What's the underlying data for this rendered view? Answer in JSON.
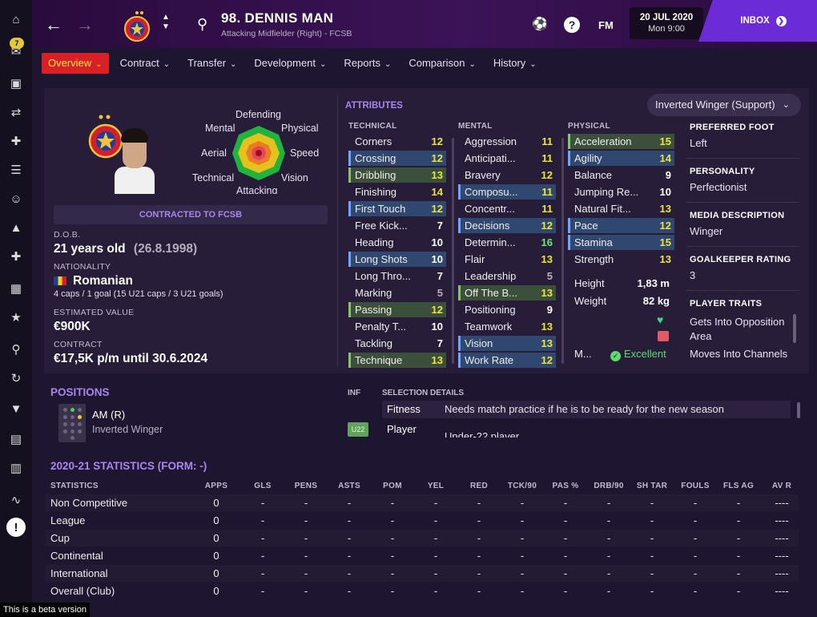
{
  "colors": {
    "accent": "#a985ec",
    "active_tab": "#d92027",
    "highlight_value": "#ece53a",
    "good": "#6fe67e",
    "inbox": "#6b2bd6"
  },
  "sidebar": {
    "badge": "7",
    "icons": [
      "home-icon",
      "inbox-icon",
      "squad-icon",
      "tactics-icon",
      "injury-icon",
      "clipboard-icon",
      "staff-icon",
      "training-icon",
      "medical-icon",
      "schedule-icon",
      "trophy-icon",
      "scouting-icon",
      "transfers-icon",
      "club-vision-icon",
      "finances-icon",
      "dev-centre-icon",
      "report-icon",
      "alert-icon"
    ]
  },
  "header": {
    "player_name": "98. DENNIS MAN",
    "player_subtitle": "Attacking Midfielder (Right) - FCSB",
    "fm_label": "FM",
    "help_label": "?",
    "date": "20 JUL 2020",
    "time": "Mon 9:00",
    "inbox_label": "INBOX"
  },
  "tabs": [
    {
      "label": "Overview",
      "active": true
    },
    {
      "label": "Contract"
    },
    {
      "label": "Transfer"
    },
    {
      "label": "Development"
    },
    {
      "label": "Reports"
    },
    {
      "label": "Comparison"
    },
    {
      "label": "History"
    }
  ],
  "radar": {
    "labels": [
      "Defending",
      "Physical",
      "Speed",
      "Vision",
      "Attacking",
      "Technical",
      "Aerial",
      "Mental"
    ]
  },
  "profile": {
    "contracted_label": "CONTRACTED TO FCSB",
    "dob_label": "D.O.B.",
    "age": "21 years old",
    "dob": "(26.8.1998)",
    "nationality_label": "NATIONALITY",
    "nationality": "Romanian",
    "caps": "4 caps / 1 goal (15 U21 caps / 3 U21 goals)",
    "value_label": "ESTIMATED VALUE",
    "value": "€900K",
    "contract_label": "CONTRACT",
    "contract": "€17,5K p/m until 30.6.2024"
  },
  "attributes": {
    "title": "ATTRIBUTES",
    "role": "Inverted Winger (Support)",
    "technical_title": "TECHNICAL",
    "mental_title": "MENTAL",
    "physical_title": "PHYSICAL",
    "technical": [
      {
        "name": "Corners",
        "value": "12",
        "hl": "",
        "color": "y"
      },
      {
        "name": "Crossing",
        "value": "12",
        "hl": "blue",
        "color": "y"
      },
      {
        "name": "Dribbling",
        "value": "13",
        "hl": "green",
        "color": "y"
      },
      {
        "name": "Finishing",
        "value": "14",
        "hl": "",
        "color": "y"
      },
      {
        "name": "First Touch",
        "value": "12",
        "hl": "blue",
        "color": "y"
      },
      {
        "name": "Free Kick...",
        "value": "7",
        "hl": "",
        "color": "w"
      },
      {
        "name": "Heading",
        "value": "10",
        "hl": "",
        "color": "w"
      },
      {
        "name": "Long Shots",
        "value": "10",
        "hl": "blue",
        "color": "w"
      },
      {
        "name": "Long Thro...",
        "value": "7",
        "hl": "",
        "color": "w"
      },
      {
        "name": "Marking",
        "value": "5",
        "hl": "",
        "color": "gr"
      },
      {
        "name": "Passing",
        "value": "12",
        "hl": "green",
        "color": "y"
      },
      {
        "name": "Penalty T...",
        "value": "10",
        "hl": "",
        "color": "w"
      },
      {
        "name": "Tackling",
        "value": "7",
        "hl": "",
        "color": "w"
      },
      {
        "name": "Technique",
        "value": "13",
        "hl": "green",
        "color": "y"
      }
    ],
    "mental": [
      {
        "name": "Aggression",
        "value": "11",
        "hl": "",
        "color": "y"
      },
      {
        "name": "Anticipati...",
        "value": "11",
        "hl": "",
        "color": "y"
      },
      {
        "name": "Bravery",
        "value": "12",
        "hl": "",
        "color": "y"
      },
      {
        "name": "Composu...",
        "value": "11",
        "hl": "blue",
        "color": "y"
      },
      {
        "name": "Concentr...",
        "value": "11",
        "hl": "",
        "color": "y"
      },
      {
        "name": "Decisions",
        "value": "12",
        "hl": "blue",
        "color": "y"
      },
      {
        "name": "Determin...",
        "value": "16",
        "hl": "",
        "color": "g"
      },
      {
        "name": "Flair",
        "value": "13",
        "hl": "",
        "color": "y"
      },
      {
        "name": "Leadership",
        "value": "5",
        "hl": "",
        "color": "gr"
      },
      {
        "name": "Off The B...",
        "value": "13",
        "hl": "green",
        "color": "y"
      },
      {
        "name": "Positioning",
        "value": "9",
        "hl": "",
        "color": "w"
      },
      {
        "name": "Teamwork",
        "value": "13",
        "hl": "",
        "color": "y"
      },
      {
        "name": "Vision",
        "value": "13",
        "hl": "blue",
        "color": "y"
      },
      {
        "name": "Work Rate",
        "value": "12",
        "hl": "blue",
        "color": "y"
      }
    ],
    "physical": [
      {
        "name": "Acceleration",
        "value": "15",
        "hl": "green",
        "color": "y"
      },
      {
        "name": "Agility",
        "value": "14",
        "hl": "blue",
        "color": "y"
      },
      {
        "name": "Balance",
        "value": "9",
        "hl": "",
        "color": "w"
      },
      {
        "name": "Jumping Re...",
        "value": "10",
        "hl": "",
        "color": "w"
      },
      {
        "name": "Natural Fit...",
        "value": "13",
        "hl": "",
        "color": "y"
      },
      {
        "name": "Pace",
        "value": "12",
        "hl": "blue",
        "color": "y"
      },
      {
        "name": "Stamina",
        "value": "15",
        "hl": "blue",
        "color": "y"
      },
      {
        "name": "Strength",
        "value": "13",
        "hl": "",
        "color": "y"
      }
    ],
    "height_label": "Height",
    "height": "1,83 m",
    "weight_label": "Weight",
    "weight": "82 kg",
    "m_label": "M...",
    "m_value": "Excellent"
  },
  "side_info": {
    "foot_label": "PREFERRED FOOT",
    "foot": "Left",
    "personality_label": "PERSONALITY",
    "personality": "Perfectionist",
    "media_label": "MEDIA DESCRIPTION",
    "media": "Winger",
    "gk_label": "GOALKEEPER RATING",
    "gk": "3",
    "traits_label": "PLAYER TRAITS",
    "trait_1a": "Gets Into Opposition",
    "trait_1b": "Area",
    "trait_2": "Moves Into Channels"
  },
  "positions": {
    "title": "POSITIONS",
    "main": "AM (R)",
    "role": "Inverted Winger"
  },
  "selection": {
    "inf_label": "INF",
    "details_label": "SELECTION DETAILS",
    "fitness_key": "Fitness",
    "fitness_val": "Needs match practice if he is to be ready for the new season",
    "player_key": "Player",
    "player_val": "Under-22 player",
    "u22": "U22"
  },
  "stats": {
    "title": "2020-21 STATISTICS (FORM: -)",
    "headers": [
      "STATISTICS",
      "APPS",
      "GLS",
      "PENS",
      "ASTS",
      "POM",
      "YEL",
      "RED",
      "TCK/90",
      "PAS %",
      "DRB/90",
      "SH TAR",
      "FOULS",
      "FLS AG",
      "AV R"
    ],
    "rows": [
      {
        "name": "Non Competitive",
        "apps": "0",
        "gls": "-",
        "pens": "-",
        "asts": "-",
        "pom": "-",
        "yel": "-",
        "red": "-",
        "tck": "-",
        "pas": "-",
        "drb": "-",
        "sht": "-",
        "fouls": "-",
        "flsag": "-",
        "avr": "----"
      },
      {
        "name": "League",
        "apps": "0",
        "gls": "-",
        "pens": "-",
        "asts": "-",
        "pom": "-",
        "yel": "-",
        "red": "-",
        "tck": "-",
        "pas": "-",
        "drb": "-",
        "sht": "-",
        "fouls": "-",
        "flsag": "-",
        "avr": "----"
      },
      {
        "name": "Cup",
        "apps": "0",
        "gls": "-",
        "pens": "-",
        "asts": "-",
        "pom": "-",
        "yel": "-",
        "red": "-",
        "tck": "-",
        "pas": "-",
        "drb": "-",
        "sht": "-",
        "fouls": "-",
        "flsag": "-",
        "avr": "----"
      },
      {
        "name": "Continental",
        "apps": "0",
        "gls": "-",
        "pens": "-",
        "asts": "-",
        "pom": "-",
        "yel": "-",
        "red": "-",
        "tck": "-",
        "pas": "-",
        "drb": "-",
        "sht": "-",
        "fouls": "-",
        "flsag": "-",
        "avr": "----"
      },
      {
        "name": "International",
        "apps": "0",
        "gls": "-",
        "pens": "-",
        "asts": "-",
        "pom": "-",
        "yel": "-",
        "red": "-",
        "tck": "-",
        "pas": "-",
        "drb": "-",
        "sht": "-",
        "fouls": "-",
        "flsag": "-",
        "avr": "----"
      },
      {
        "name": "Overall (Club)",
        "apps": "0",
        "gls": "-",
        "pens": "-",
        "asts": "-",
        "pom": "-",
        "yel": "-",
        "red": "-",
        "tck": "-",
        "pas": "-",
        "drb": "-",
        "sht": "-",
        "fouls": "-",
        "flsag": "-",
        "avr": "----"
      }
    ]
  },
  "beta_note": "This is a beta version"
}
